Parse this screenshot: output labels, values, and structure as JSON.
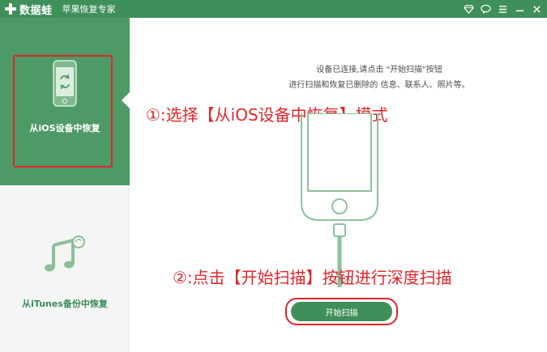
{
  "titlebar": {
    "brand": "数据蛙",
    "subtitle": "苹果恢复专家",
    "controls": [
      "diamond-icon",
      "chat-icon",
      "menu-icon",
      "minimize-icon",
      "close-icon"
    ]
  },
  "sidebar": {
    "modes": [
      {
        "label": "从iOS设备中恢复",
        "icon": "phone-refresh-icon",
        "selected": true
      },
      {
        "label": "从iTunes备份中恢复",
        "icon": "music-note-icon",
        "selected": false
      }
    ]
  },
  "main": {
    "info_line_1": "设备已连接,请点击 \"开始扫描\"按钮",
    "info_line_2": "进行扫描和恢复已删除的 信息、联系人、照片等。",
    "annotation_1": "①:选择【从iOS设备中恢复】模式",
    "annotation_2": "②:点击【开始扫描】按钮进行深度扫描",
    "device_label": "(N/A)",
    "start_button": "开始扫描"
  },
  "colors": {
    "brand_green": "#3f8f5a",
    "sidebar_selected": "#4e9a66",
    "annotation_red": "#e0262a"
  }
}
